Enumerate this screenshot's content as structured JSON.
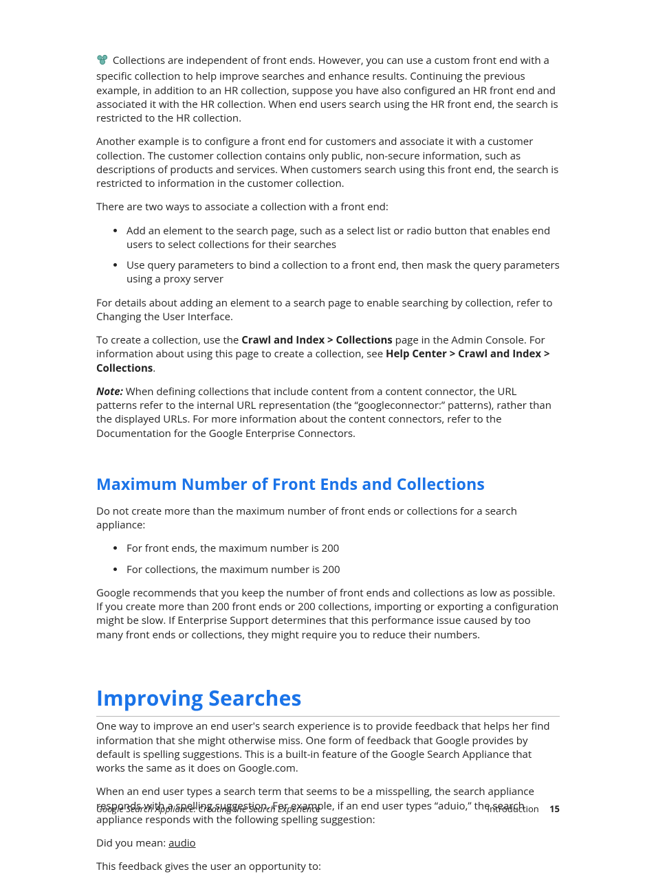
{
  "para1": " Collections are independent of front ends. However, you can use a custom front end with a specific collection to help improve searches and enhance results. Continuing the previous example, in addition to an HR collection, suppose you have also configured an HR front end and associated it with the HR collection. When end users search using the HR front end, the search is restricted to the HR collection.",
  "para2": "Another example is to configure a front end for customers and associate it with a customer collection. The customer collection contains only public, non-secure information, such as descriptions of products and services. When customers search using this front end, the search is restricted to information in the customer collection.",
  "para3": "There are two ways to associate a collection with a front end:",
  "bullets1": [
    "Add an element to the search page, such as a select list or radio button that enables end users to select collections for their searches",
    "Use query parameters to bind a collection to a front end, then mask the query parameters using a proxy server"
  ],
  "para4": "For details about adding an element to a search page to enable searching by collection, refer to Changing the User Interface.",
  "para5_pre": "To create a collection, use the ",
  "para5_b1": "Crawl and Index > Collections",
  "para5_mid": " page in the Admin Console. For information about using this page to create a collection, see ",
  "para5_b2": "Help Center > Crawl and Index > Collections",
  "para5_post": ".",
  "note_label": "Note:",
  "note_body": "  When defining collections that include content from a content connector, the URL patterns refer to the internal URL representation (the “googleconnector:” patterns), rather than the displayed URLs. For more information about the content connectors, refer to the Documentation for the Google Enterprise Connectors.",
  "h2_max": "Maximum Number of Front Ends and Collections",
  "para_max_intro": "Do not create more than the maximum number of front ends or collections for a search appliance:",
  "bullets2": [
    "For front ends, the maximum number is 200",
    "For collections, the maximum number is 200"
  ],
  "para_max_reco": "Google recommends that you keep the number of front ends and collections as low as possible. If you create more than 200 front ends or 200 collections, importing or exporting a configuration might be slow. If Enterprise Support determines that this performance issue caused by too many front ends or collections, they might require you to reduce their numbers.",
  "h1_improv": "Improving Searches",
  "para_improv_1": "One way to improve an end user's search experience is to provide feedback that helps her find information that she might otherwise miss. One form of feedback that Google provides by default is spelling suggestions. This is a built-in feature of the Google Search Appliance that works the same as it does on Google.com.",
  "para_improv_2": "When an end user types a search term that seems to be a misspelling, the search appliance responds with a spelling suggestion. For example, if an end user types “aduio,” the search appliance responds with the following spelling suggestion:",
  "did_you_mean_pre": "Did you mean: ",
  "did_you_mean_link": "audio",
  "para_improv_3": "This feedback gives the user an opportunity to:",
  "footer_left": "Google Search Appliance: Creating the Search Experience",
  "footer_section": "Introduction",
  "footer_page": "15"
}
